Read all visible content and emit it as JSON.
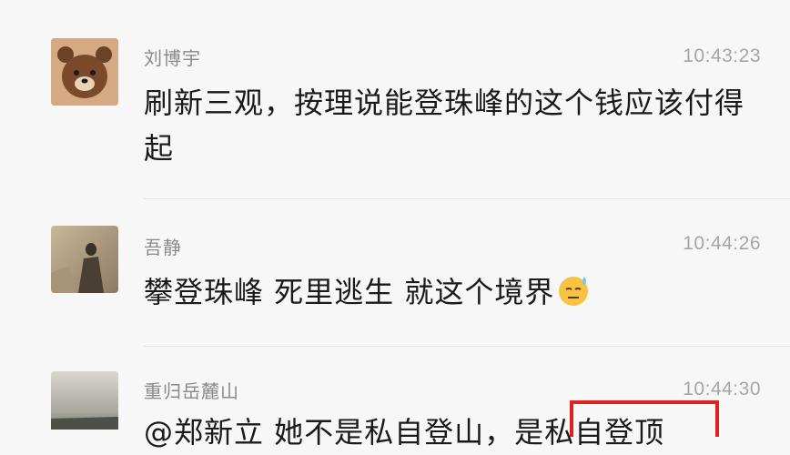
{
  "messages": [
    {
      "sender": "刘博宇",
      "time": "10:43:23",
      "text": "刷新三观，按理说能登珠峰的这个钱应该付得起",
      "avatar_icon": "brown-bear-avatar"
    },
    {
      "sender": "吾静",
      "time": "10:44:26",
      "text": "攀登珠峰 死里逃生 就这个境界",
      "emoji": "sweat-smile-emoji",
      "avatar_icon": "photo-avatar"
    },
    {
      "sender": "重归岳麓山",
      "time": "10:44:30",
      "text": "@郑新立 她不是私自登山，是私自登顶",
      "avatar_icon": "landscape-avatar"
    }
  ],
  "colors": {
    "background": "#f7f7f7",
    "highlight": "#e0211c"
  }
}
